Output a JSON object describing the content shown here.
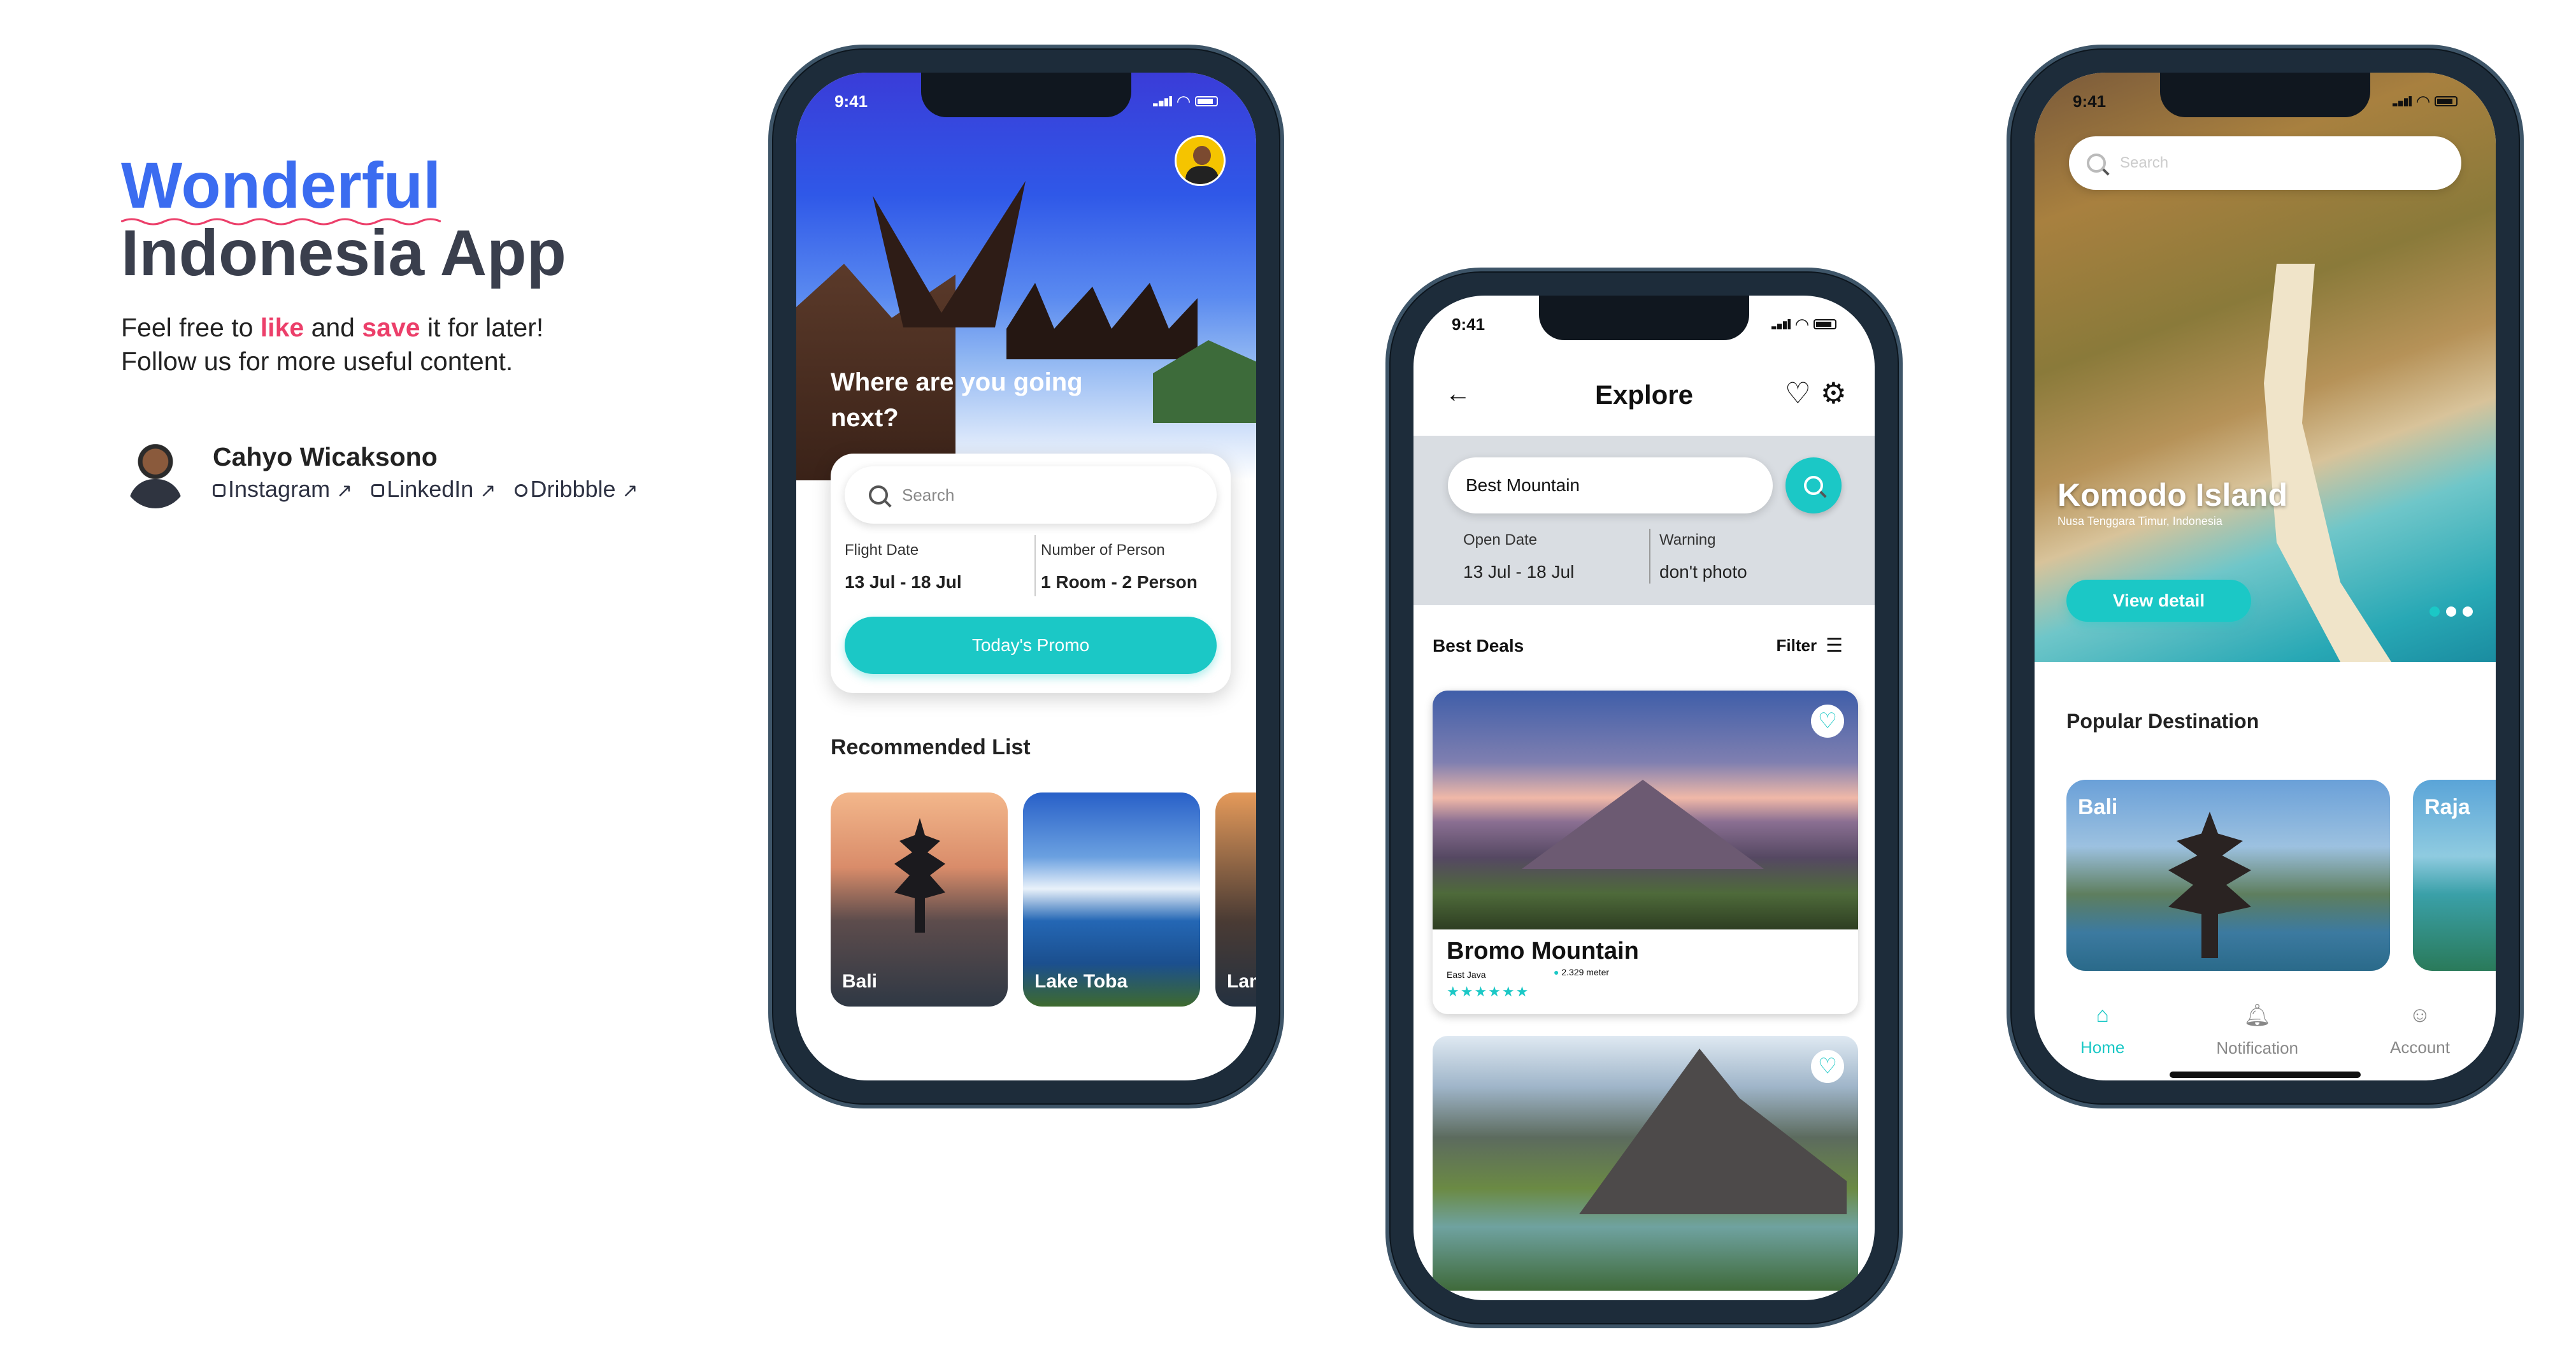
{
  "intro": {
    "title_line1": "Wonderful",
    "title_line2": "Indonesia App",
    "subtitle_pre": "Feel free to ",
    "subtitle_like": "like",
    "subtitle_mid": " and ",
    "subtitle_save": "save",
    "subtitle_post": " it for later!",
    "subtitle_line2": "Follow us for more useful content.",
    "author_name": "Cahyo Wicaksono",
    "links": [
      "Instagram",
      "LinkedIn",
      "Dribbble"
    ],
    "colors": {
      "title_blue": "#3b6cf0",
      "highlight": "#ec3f6a",
      "accent": "#1bc8c6"
    }
  },
  "phone1": {
    "time": "9:41",
    "headline": "Where are you going next?",
    "search_placeholder": "Search",
    "flight_date_label": "Flight Date",
    "flight_date_value": "13 Jul - 18 Jul",
    "persons_label": "Number of Person",
    "persons_value": "1 Room - 2 Person",
    "promo_button": "Today's Promo",
    "recommended_title": "Recommended List",
    "recommended": [
      "Bali",
      "Lake Toba",
      "Lam"
    ]
  },
  "phone2": {
    "time": "9:41",
    "title": "Explore",
    "search_value": "Best Mountain",
    "open_date_label": "Open Date",
    "open_date_value": "13 Jul - 18 Jul",
    "warning_label": "Warning",
    "warning_value": "don't photo",
    "best_deals": "Best Deals",
    "filter": "Filter",
    "card1": {
      "name": "Bromo Mountain",
      "location": "East Java",
      "height": "2.329 meter",
      "stars": "★★★★★★"
    }
  },
  "phone3": {
    "time": "9:41",
    "search_placeholder": "Search",
    "hero_title": "Komodo Island",
    "hero_subtitle": "Nusa Tenggara Timur, Indonesia",
    "view_detail": "View detail",
    "popular_title": "Popular Destination",
    "popular": [
      "Bali",
      "Raja"
    ],
    "nav": [
      "Home",
      "Notification",
      "Account"
    ]
  }
}
